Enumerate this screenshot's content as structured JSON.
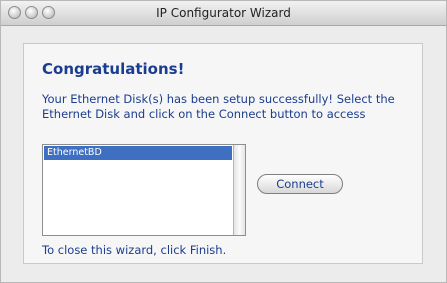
{
  "window": {
    "title": "IP Configurator Wizard",
    "traffic_lights": [
      "close-icon",
      "minimize-icon",
      "zoom-icon"
    ]
  },
  "content": {
    "heading": "Congratulations!",
    "description": "Your Ethernet Disk(s) has been setup successfully! Select the Ethernet Disk and click on the Connect button to access",
    "disks": [
      "EthernetBD"
    ],
    "selected_disk": "EthernetBD",
    "connect_label": "Connect",
    "footer": "To close this wizard, click Finish."
  },
  "colors": {
    "text_blue": "#1b3d8f",
    "selection": "#3f6fc1"
  }
}
